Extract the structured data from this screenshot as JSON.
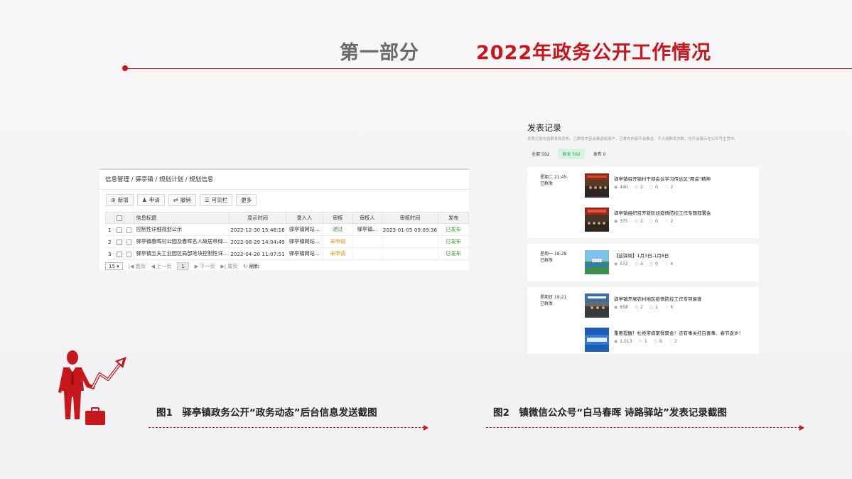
{
  "header": {
    "part": "第一部分",
    "title": "2022年政务公开工作情况"
  },
  "admin": {
    "breadcrumb": "信息管理 / 驿亭镇 / 规划计划 / 规划信息",
    "toolbar": [
      {
        "icon": "plus-circle-icon",
        "glyph": "⊕",
        "label": "新增"
      },
      {
        "icon": "user-icon",
        "glyph": "👤",
        "label": "申请"
      },
      {
        "icon": "revoke-icon",
        "glyph": "⇄",
        "label": "撤销"
      },
      {
        "icon": "list-icon",
        "glyph": "☰",
        "label": "可见栏"
      },
      {
        "icon": "",
        "glyph": "",
        "label": "更多"
      }
    ],
    "columns": [
      "信息标题",
      "显示时间",
      "录入人",
      "审核",
      "审核人",
      "审核时间",
      "发布"
    ],
    "rows": [
      {
        "num": "1",
        "title": "控制性详细规划公示",
        "time": "2022-12-30 15:48:16",
        "author": "驿亭镇网站...",
        "review": "通过",
        "reviewer": "驿亭镇...",
        "review_time": "2023-01-05 09:09:36",
        "publish": "已发布"
      },
      {
        "num": "2",
        "title": "驿亭镇春晖村公园及春晖名人故居带绿...",
        "time": "2022-08-29 14:04:49",
        "author": "驿亭镇网站...",
        "review": "未申请",
        "reviewer": "",
        "review_time": "",
        "publish": "已发布"
      },
      {
        "num": "3",
        "title": "驿亭镇五夫工业园区局部地块控制性详...",
        "time": "2022-04-20 11:07:51",
        "author": "驿亭镇网站...",
        "review": "未申请",
        "reviewer": "",
        "review_time": "",
        "publish": "已发布"
      }
    ],
    "pager": {
      "page_size": "15",
      "first": "首页",
      "prev": "上一页",
      "page": "1",
      "next": "下一页",
      "last": "尾页",
      "refresh": "刷新"
    }
  },
  "publish": {
    "title": "发表记录",
    "description": "发表记录包括群发和发布。已群发内容会推送给用户，已发布内容不会推送，不占用群发次数，也不会展示在公众号主页中。",
    "tabs": [
      {
        "label": "全部 592"
      },
      {
        "label": "群发 592"
      },
      {
        "label": "发布 0"
      }
    ],
    "groups": [
      {
        "date": "星期二 21:45",
        "status": "已群发",
        "articles": [
          {
            "title": "驿亭镇召开镇村干部会议学习传达区\"两会\"精神",
            "views": "440",
            "shares": "2",
            "comments": "0",
            "likes": "2"
          },
          {
            "title": "驿亭镇组织召开新阶段疫情防控工作专题部署会",
            "views": "375",
            "shares": "2",
            "comments": "0",
            "likes": "2"
          }
        ]
      },
      {
        "date": "星期一 18:28",
        "status": "已群发",
        "articles": [
          {
            "title": "【这驿周】1月3日-1月8日",
            "views": "572",
            "shares": "3",
            "comments": "0",
            "likes": "4"
          }
        ]
      },
      {
        "date": "星期日 19:21",
        "status": "已群发",
        "articles": [
          {
            "title": "驿亭镇开展农村地区疫情防控工作专项督查",
            "views": "658",
            "shares": "2",
            "comments": "1",
            "likes": "6"
          },
          {
            "title": "重要提醒！杜绝带病聚餐聚会！还有事关红白喜事、春节返乡！",
            "views": "1,013",
            "shares": "1",
            "comments": "0",
            "likes": "2"
          }
        ]
      }
    ]
  },
  "captions": {
    "fig1": "图1　驿亭镇政务公开“政务动态”后台信息发送截图",
    "fig2": "图2　镇微信公众号“白马春晖 诗路驿站”发表记录截图"
  },
  "colors": {
    "accent": "#c8161d",
    "green": "#2f9e2f",
    "orange": "#f08a00"
  }
}
